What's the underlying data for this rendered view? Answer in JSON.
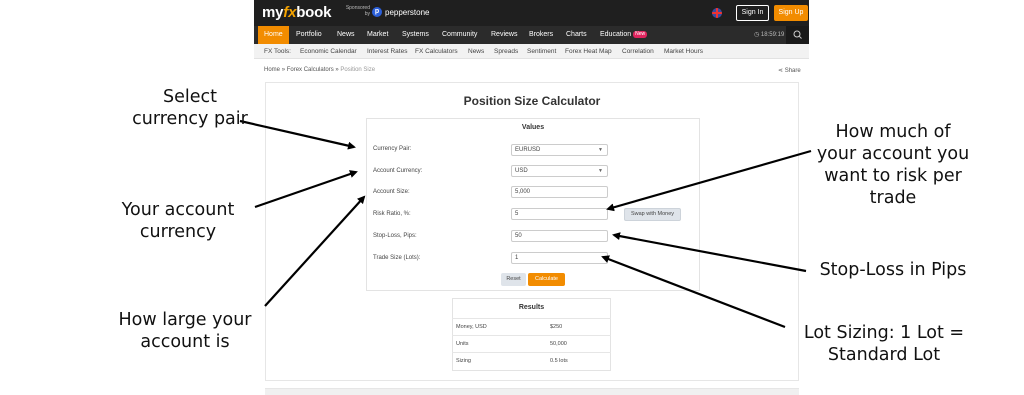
{
  "header": {
    "logo_prefix": "my",
    "logo_fx": "fx",
    "logo_suffix": "book",
    "sponsored_by": "Sponsored by",
    "sponsor": "pepperstone",
    "sign_in": "Sign In",
    "sign_up": "Sign Up"
  },
  "nav": {
    "items": [
      "Home",
      "Portfolio",
      "News",
      "Market",
      "Systems",
      "Community",
      "Reviews",
      "Brokers",
      "Charts",
      "Education"
    ],
    "new_badge": "New",
    "time": "18:59:19"
  },
  "fx_tools": {
    "label": "FX Tools:",
    "items": [
      "Economic Calendar",
      "Interest Rates",
      "FX Calculators",
      "News",
      "Spreads",
      "Sentiment",
      "Forex Heat Map",
      "Correlation",
      "Market Hours"
    ]
  },
  "breadcrumb": {
    "home": "Home",
    "sep": "»",
    "calculators": "Forex Calculators",
    "current": "Position Size"
  },
  "share": "Share",
  "calculator": {
    "title": "Position Size Calculator",
    "values_heading": "Values",
    "currency_pair_label": "Currency Pair:",
    "currency_pair_value": "EURUSD",
    "account_currency_label": "Account Currency:",
    "account_currency_value": "USD",
    "account_size_label": "Account Size:",
    "account_size_value": "5,000",
    "risk_ratio_label": "Risk Ratio, %:",
    "risk_ratio_value": "5",
    "swap_button": "Swap with Money",
    "stop_loss_label": "Stop-Loss, Pips:",
    "stop_loss_value": "50",
    "trade_size_label": "Trade Size (Lots):",
    "trade_size_value": "1",
    "reset_button": "Reset",
    "calculate_button": "Calculate"
  },
  "results": {
    "heading": "Results",
    "rows": [
      {
        "label": "Money, USD",
        "value": "$250"
      },
      {
        "label": "Units",
        "value": "50,000"
      },
      {
        "label": "Sizing",
        "value": "0.5 lots"
      }
    ]
  },
  "annotations": {
    "select_pair": [
      "Select",
      "currency pair"
    ],
    "account_currency": [
      "Your account",
      "currency"
    ],
    "account_size": [
      "How large your",
      "account is"
    ],
    "risk": [
      "How much of",
      "your account you",
      "want to risk per",
      "trade"
    ],
    "stop_loss": "Stop-Loss in Pips",
    "lot_sizing": [
      "Lot Sizing: 1 Lot =",
      "Standard Lot"
    ]
  }
}
